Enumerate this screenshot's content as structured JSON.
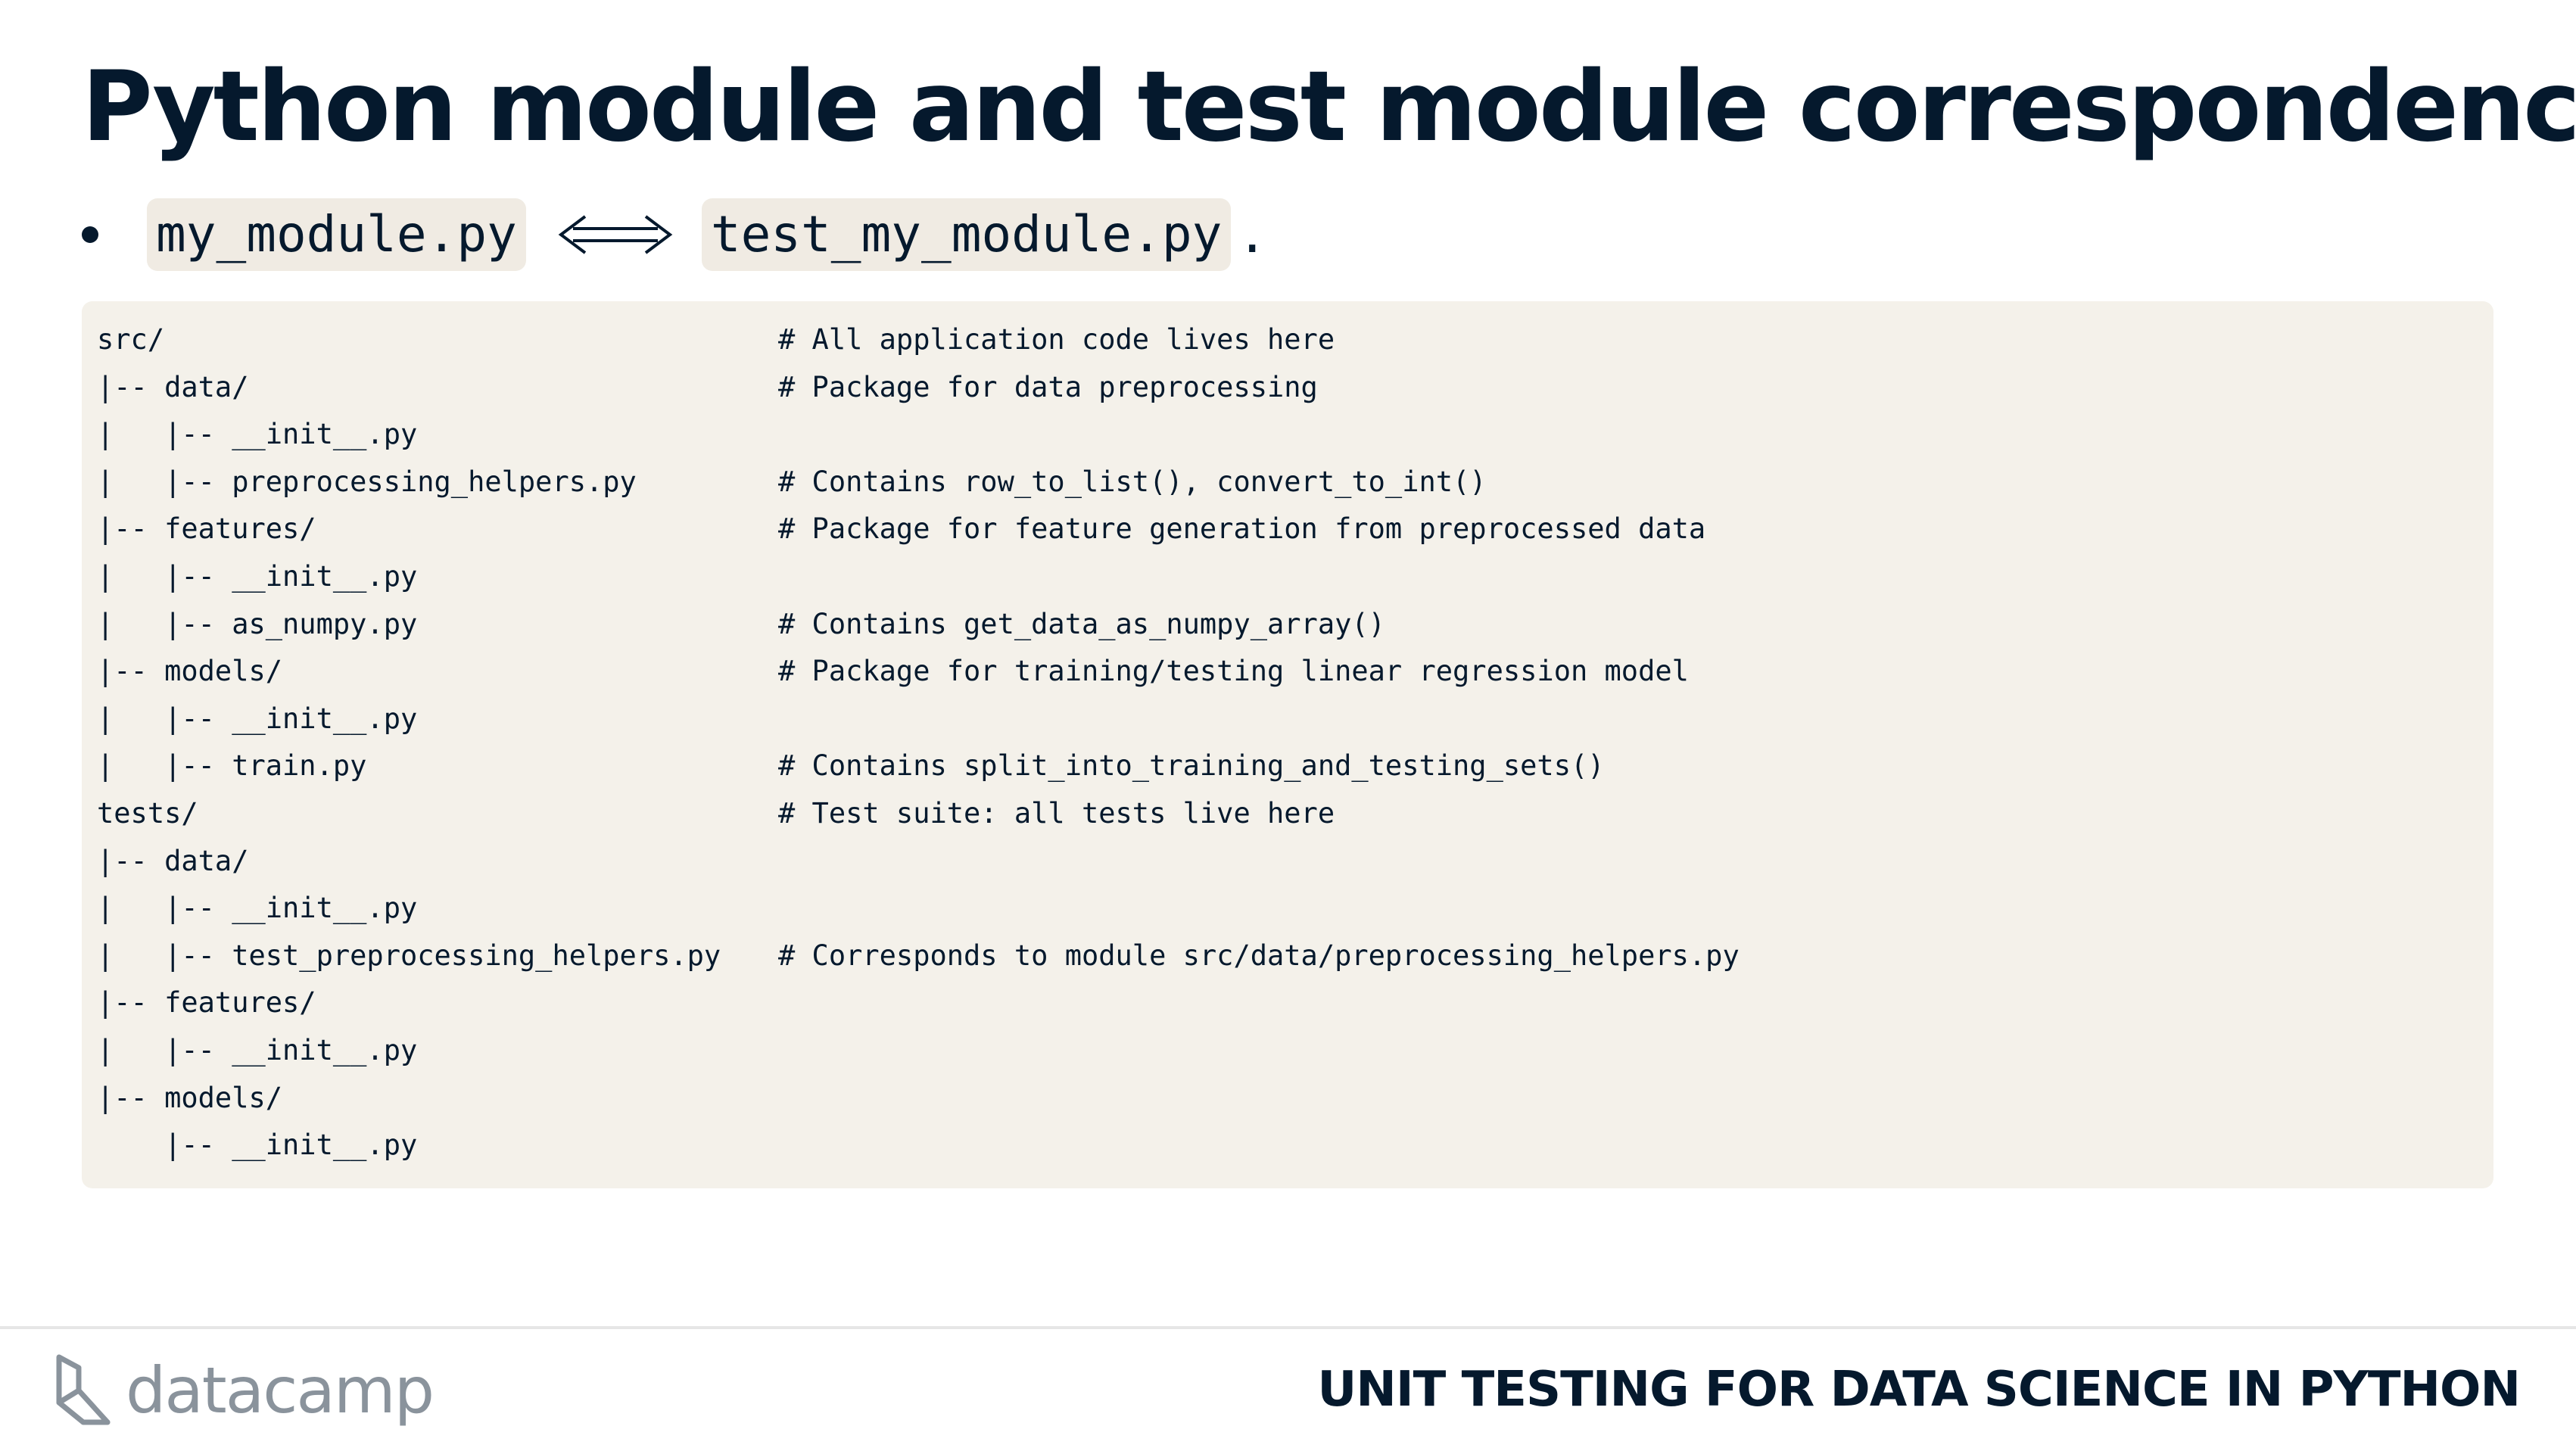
{
  "title": "Python module and test module correspondence",
  "bullet": {
    "left_code": "my_module.py",
    "arrow_symbol": "⟺",
    "right_code": "test_my_module.py",
    "suffix": "."
  },
  "code_block": {
    "lines": [
      {
        "path": "src/",
        "comment": "# All application code lives here"
      },
      {
        "path": "|-- data/",
        "comment": "# Package for data preprocessing"
      },
      {
        "path": "|   |-- __init__.py",
        "comment": ""
      },
      {
        "path": "|   |-- preprocessing_helpers.py",
        "comment": "# Contains row_to_list(), convert_to_int()"
      },
      {
        "path": "|-- features/",
        "comment": "# Package for feature generation from preprocessed data"
      },
      {
        "path": "|   |-- __init__.py",
        "comment": ""
      },
      {
        "path": "|   |-- as_numpy.py",
        "comment": "# Contains get_data_as_numpy_array()"
      },
      {
        "path": "|-- models/",
        "comment": "# Package for training/testing linear regression model"
      },
      {
        "path": "|   |-- __init__.py",
        "comment": ""
      },
      {
        "path": "|   |-- train.py",
        "comment": "# Contains split_into_training_and_testing_sets()"
      },
      {
        "path": "tests/",
        "comment": "# Test suite: all tests live here"
      },
      {
        "path": "|-- data/",
        "comment": ""
      },
      {
        "path": "|   |-- __init__.py",
        "comment": ""
      },
      {
        "path": "|   |-- test_preprocessing_helpers.py",
        "comment": "# Corresponds to module src/data/preprocessing_helpers.py"
      },
      {
        "path": "|-- features/",
        "comment": ""
      },
      {
        "path": "|   |-- __init__.py",
        "comment": ""
      },
      {
        "path": "|-- models/",
        "comment": ""
      },
      {
        "path": "    |-- __init__.py",
        "comment": ""
      }
    ]
  },
  "footer": {
    "logo_text": "datacamp",
    "course_name": "UNIT TESTING FOR DATA SCIENCE IN PYTHON"
  },
  "colors": {
    "text": "#05192d",
    "code_background": "#f4f1ea",
    "logo_gray": "#8a939c"
  },
  "icons": {
    "bullet": "bullet-dot-icon",
    "arrow": "double-arrow-icon",
    "logo": "datacamp-logo-icon"
  }
}
